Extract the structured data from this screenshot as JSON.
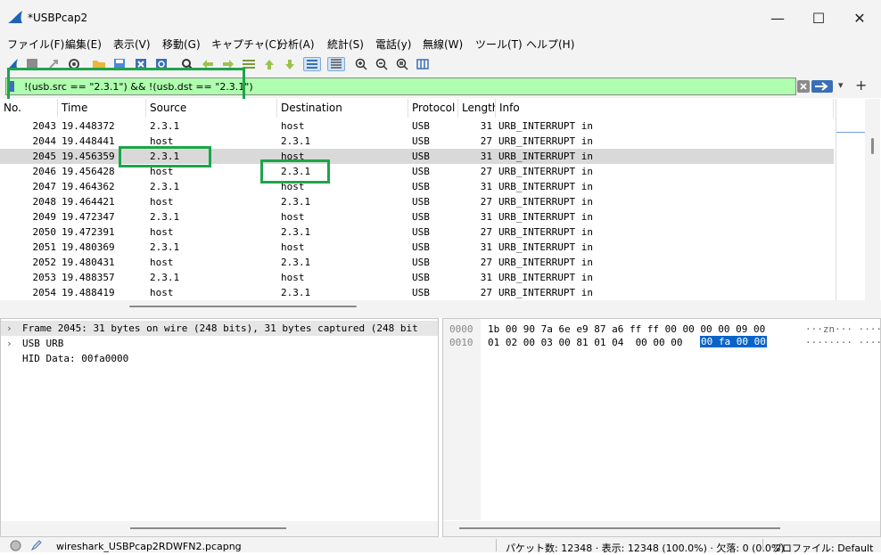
{
  "window": {
    "title": "*USBPcap2",
    "minimize": "—",
    "maximize": "☐",
    "close": "✕"
  },
  "menu": [
    "ファイル(F)",
    "編集(E)",
    "表示(V)",
    "移動(G)",
    "キャプチャ(C)",
    "分析(A)",
    "統計(S)",
    "電話(y)",
    "無線(W)",
    "ツール(T)",
    "ヘルプ(H)"
  ],
  "toolbar": {
    "icons": [
      "shark-fin-icon",
      "stop-icon",
      "restart-icon",
      "options-gear-icon",
      "open-folder-icon",
      "save-icon",
      "close-file-icon",
      "reload-icon",
      "find-icon",
      "go-back-icon",
      "go-forward-icon",
      "go-to-packet-icon",
      "first-packet-icon",
      "last-packet-icon",
      "autoscroll-icon",
      "colorize-icon",
      "zoom-in-icon",
      "zoom-out-icon",
      "zoom-normal-icon",
      "resize-columns-icon"
    ]
  },
  "filter": {
    "value": "!(usb.src == \"2.3.1\") && !(usb.dst == \"2.3.1\")",
    "plus": "+",
    "dropdown": "▾"
  },
  "columns": [
    "No.",
    "Time",
    "Source",
    "Destination",
    "Protocol",
    "Length",
    "Info"
  ],
  "packets": [
    {
      "no": "2043",
      "time": "19.448372",
      "src": "2.3.1",
      "dst": "host",
      "proto": "USB",
      "len": "31",
      "info": "URB_INTERRUPT in"
    },
    {
      "no": "2044",
      "time": "19.448441",
      "src": "host",
      "dst": "2.3.1",
      "proto": "USB",
      "len": "27",
      "info": "URB_INTERRUPT in"
    },
    {
      "no": "2045",
      "time": "19.456359",
      "src": "2.3.1",
      "dst": "host",
      "proto": "USB",
      "len": "31",
      "info": "URB_INTERRUPT in"
    },
    {
      "no": "2046",
      "time": "19.456428",
      "src": "host",
      "dst": "2.3.1",
      "proto": "USB",
      "len": "27",
      "info": "URB_INTERRUPT in"
    },
    {
      "no": "2047",
      "time": "19.464362",
      "src": "2.3.1",
      "dst": "host",
      "proto": "USB",
      "len": "31",
      "info": "URB_INTERRUPT in"
    },
    {
      "no": "2048",
      "time": "19.464421",
      "src": "host",
      "dst": "2.3.1",
      "proto": "USB",
      "len": "27",
      "info": "URB_INTERRUPT in"
    },
    {
      "no": "2049",
      "time": "19.472347",
      "src": "2.3.1",
      "dst": "host",
      "proto": "USB",
      "len": "31",
      "info": "URB_INTERRUPT in"
    },
    {
      "no": "2050",
      "time": "19.472391",
      "src": "host",
      "dst": "2.3.1",
      "proto": "USB",
      "len": "27",
      "info": "URB_INTERRUPT in"
    },
    {
      "no": "2051",
      "time": "19.480369",
      "src": "2.3.1",
      "dst": "host",
      "proto": "USB",
      "len": "31",
      "info": "URB_INTERRUPT in"
    },
    {
      "no": "2052",
      "time": "19.480431",
      "src": "host",
      "dst": "2.3.1",
      "proto": "USB",
      "len": "27",
      "info": "URB_INTERRUPT in"
    },
    {
      "no": "2053",
      "time": "19.488357",
      "src": "2.3.1",
      "dst": "host",
      "proto": "USB",
      "len": "31",
      "info": "URB_INTERRUPT in"
    },
    {
      "no": "2054",
      "time": "19.488419",
      "src": "host",
      "dst": "2.3.1",
      "proto": "USB",
      "len": "27",
      "info": "URB_INTERRUPT in"
    }
  ],
  "selected_packet": "2045",
  "details": [
    {
      "expander": "›",
      "text": "Frame 2045: 31 bytes on wire (248 bits), 31 bytes captured (248 bit"
    },
    {
      "expander": "›",
      "text": "USB URB"
    },
    {
      "expander": "",
      "text": "HID Data: 00fa0000"
    }
  ],
  "bytes": [
    {
      "offset": "0000",
      "hex": "1b 00 90 7a 6e e9 87 a6  ff ff 00 00 00 00 09 00",
      "hex_selected": "",
      "ascii": "···zn···  ········"
    },
    {
      "offset": "0010",
      "hex": "01 02 00 03 00 81 01 04  00 00 00 ",
      "hex_selected": "00 fa 00 00",
      "ascii": "········  ········"
    }
  ],
  "status": {
    "file": "wireshark_USBPcap2RDWFN2.pcapng",
    "counts": "パケット数: 12348 · 表示: 12348 (100.0%) · 欠落: 0 (0.0%)",
    "profile": "プロファイル: Default"
  },
  "colors": {
    "filter_ok": "#afffaf",
    "highlight_box": "#1ea44a",
    "selected_row": "#d9d9d9",
    "byte_selection": "#0a64c8"
  }
}
